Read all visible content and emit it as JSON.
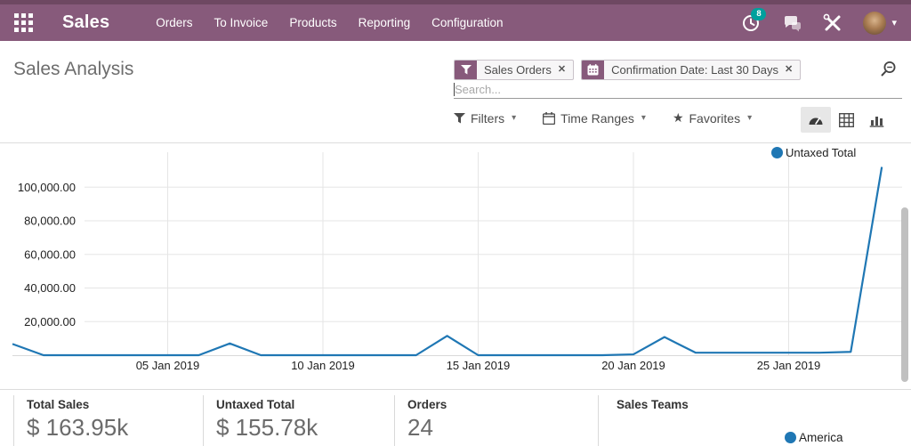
{
  "nav": {
    "brand": "Sales",
    "items": [
      {
        "label": "Orders"
      },
      {
        "label": "To Invoice"
      },
      {
        "label": "Products"
      },
      {
        "label": "Reporting"
      },
      {
        "label": "Configuration"
      }
    ],
    "activity_badge": "8"
  },
  "control": {
    "title": "Sales Analysis",
    "facets": [
      {
        "icon": "filter-icon",
        "label": "Sales Orders"
      },
      {
        "icon": "calendar-icon",
        "label": "Confirmation Date: Last 30 Days"
      }
    ],
    "search_placeholder": "Search...",
    "buttons": [
      {
        "icon": "filter-icon",
        "label": "Filters"
      },
      {
        "icon": "calendar-icon",
        "label": "Time Ranges"
      },
      {
        "icon": "star-icon",
        "label": "Favorites"
      }
    ],
    "view_switcher": [
      "dashboard",
      "pivot",
      "graph"
    ],
    "active_view": "dashboard"
  },
  "chart_data": {
    "type": "line",
    "title": "",
    "legend_position": "top-right",
    "grid": true,
    "ylim": [
      0,
      115000
    ],
    "y_ticks": [
      20000,
      40000,
      60000,
      80000,
      100000
    ],
    "y_tick_labels": [
      "20,000.00",
      "40,000.00",
      "60,000.00",
      "80,000.00",
      "100,000.00"
    ],
    "x_tick_labels": [
      "05 Jan 2019",
      "10 Jan 2019",
      "15 Jan 2019",
      "20 Jan 2019",
      "25 Jan 2019"
    ],
    "x_tick_indices": [
      5,
      10,
      15,
      20,
      25
    ],
    "series": [
      {
        "name": "Untaxed Total",
        "color": "#1f77b4",
        "x": [
          "31 Dec 2018",
          "01 Jan 2019",
          "02 Jan 2019",
          "03 Jan 2019",
          "04 Jan 2019",
          "05 Jan 2019",
          "06 Jan 2019",
          "07 Jan 2019",
          "08 Jan 2019",
          "09 Jan 2019",
          "10 Jan 2019",
          "11 Jan 2019",
          "12 Jan 2019",
          "13 Jan 2019",
          "14 Jan 2019",
          "15 Jan 2019",
          "16 Jan 2019",
          "17 Jan 2019",
          "18 Jan 2019",
          "19 Jan 2019",
          "20 Jan 2019",
          "21 Jan 2019",
          "22 Jan 2019",
          "23 Jan 2019",
          "24 Jan 2019",
          "25 Jan 2019",
          "26 Jan 2019",
          "27 Jan 2019",
          "28 Jan 2019"
        ],
        "values": [
          6700,
          0,
          0,
          0,
          0,
          0,
          0,
          7000,
          0,
          0,
          0,
          0,
          0,
          0,
          11500,
          0,
          0,
          0,
          0,
          0,
          500,
          10800,
          1500,
          1500,
          1500,
          1500,
          1500,
          2000,
          112000
        ]
      }
    ]
  },
  "stats": {
    "items": [
      {
        "label": "Total Sales",
        "value": "$ 163.95k"
      },
      {
        "label": "Untaxed Total",
        "value": "$ 155.78k"
      },
      {
        "label": "Orders",
        "value": "24"
      },
      {
        "label": "Sales Teams",
        "value": ""
      }
    ],
    "teams_legend": {
      "label": "America",
      "color": "#1f77b4"
    }
  },
  "colors": {
    "navbar": "#875A7B",
    "navbar_top_strip": "#6e4862",
    "notification_badge": "#00A09D",
    "line_series": "#1f77b4",
    "gridline": "#e5e5e5"
  },
  "glyphs": {
    "close": "✕",
    "caret_down": "▾",
    "star": "★"
  }
}
